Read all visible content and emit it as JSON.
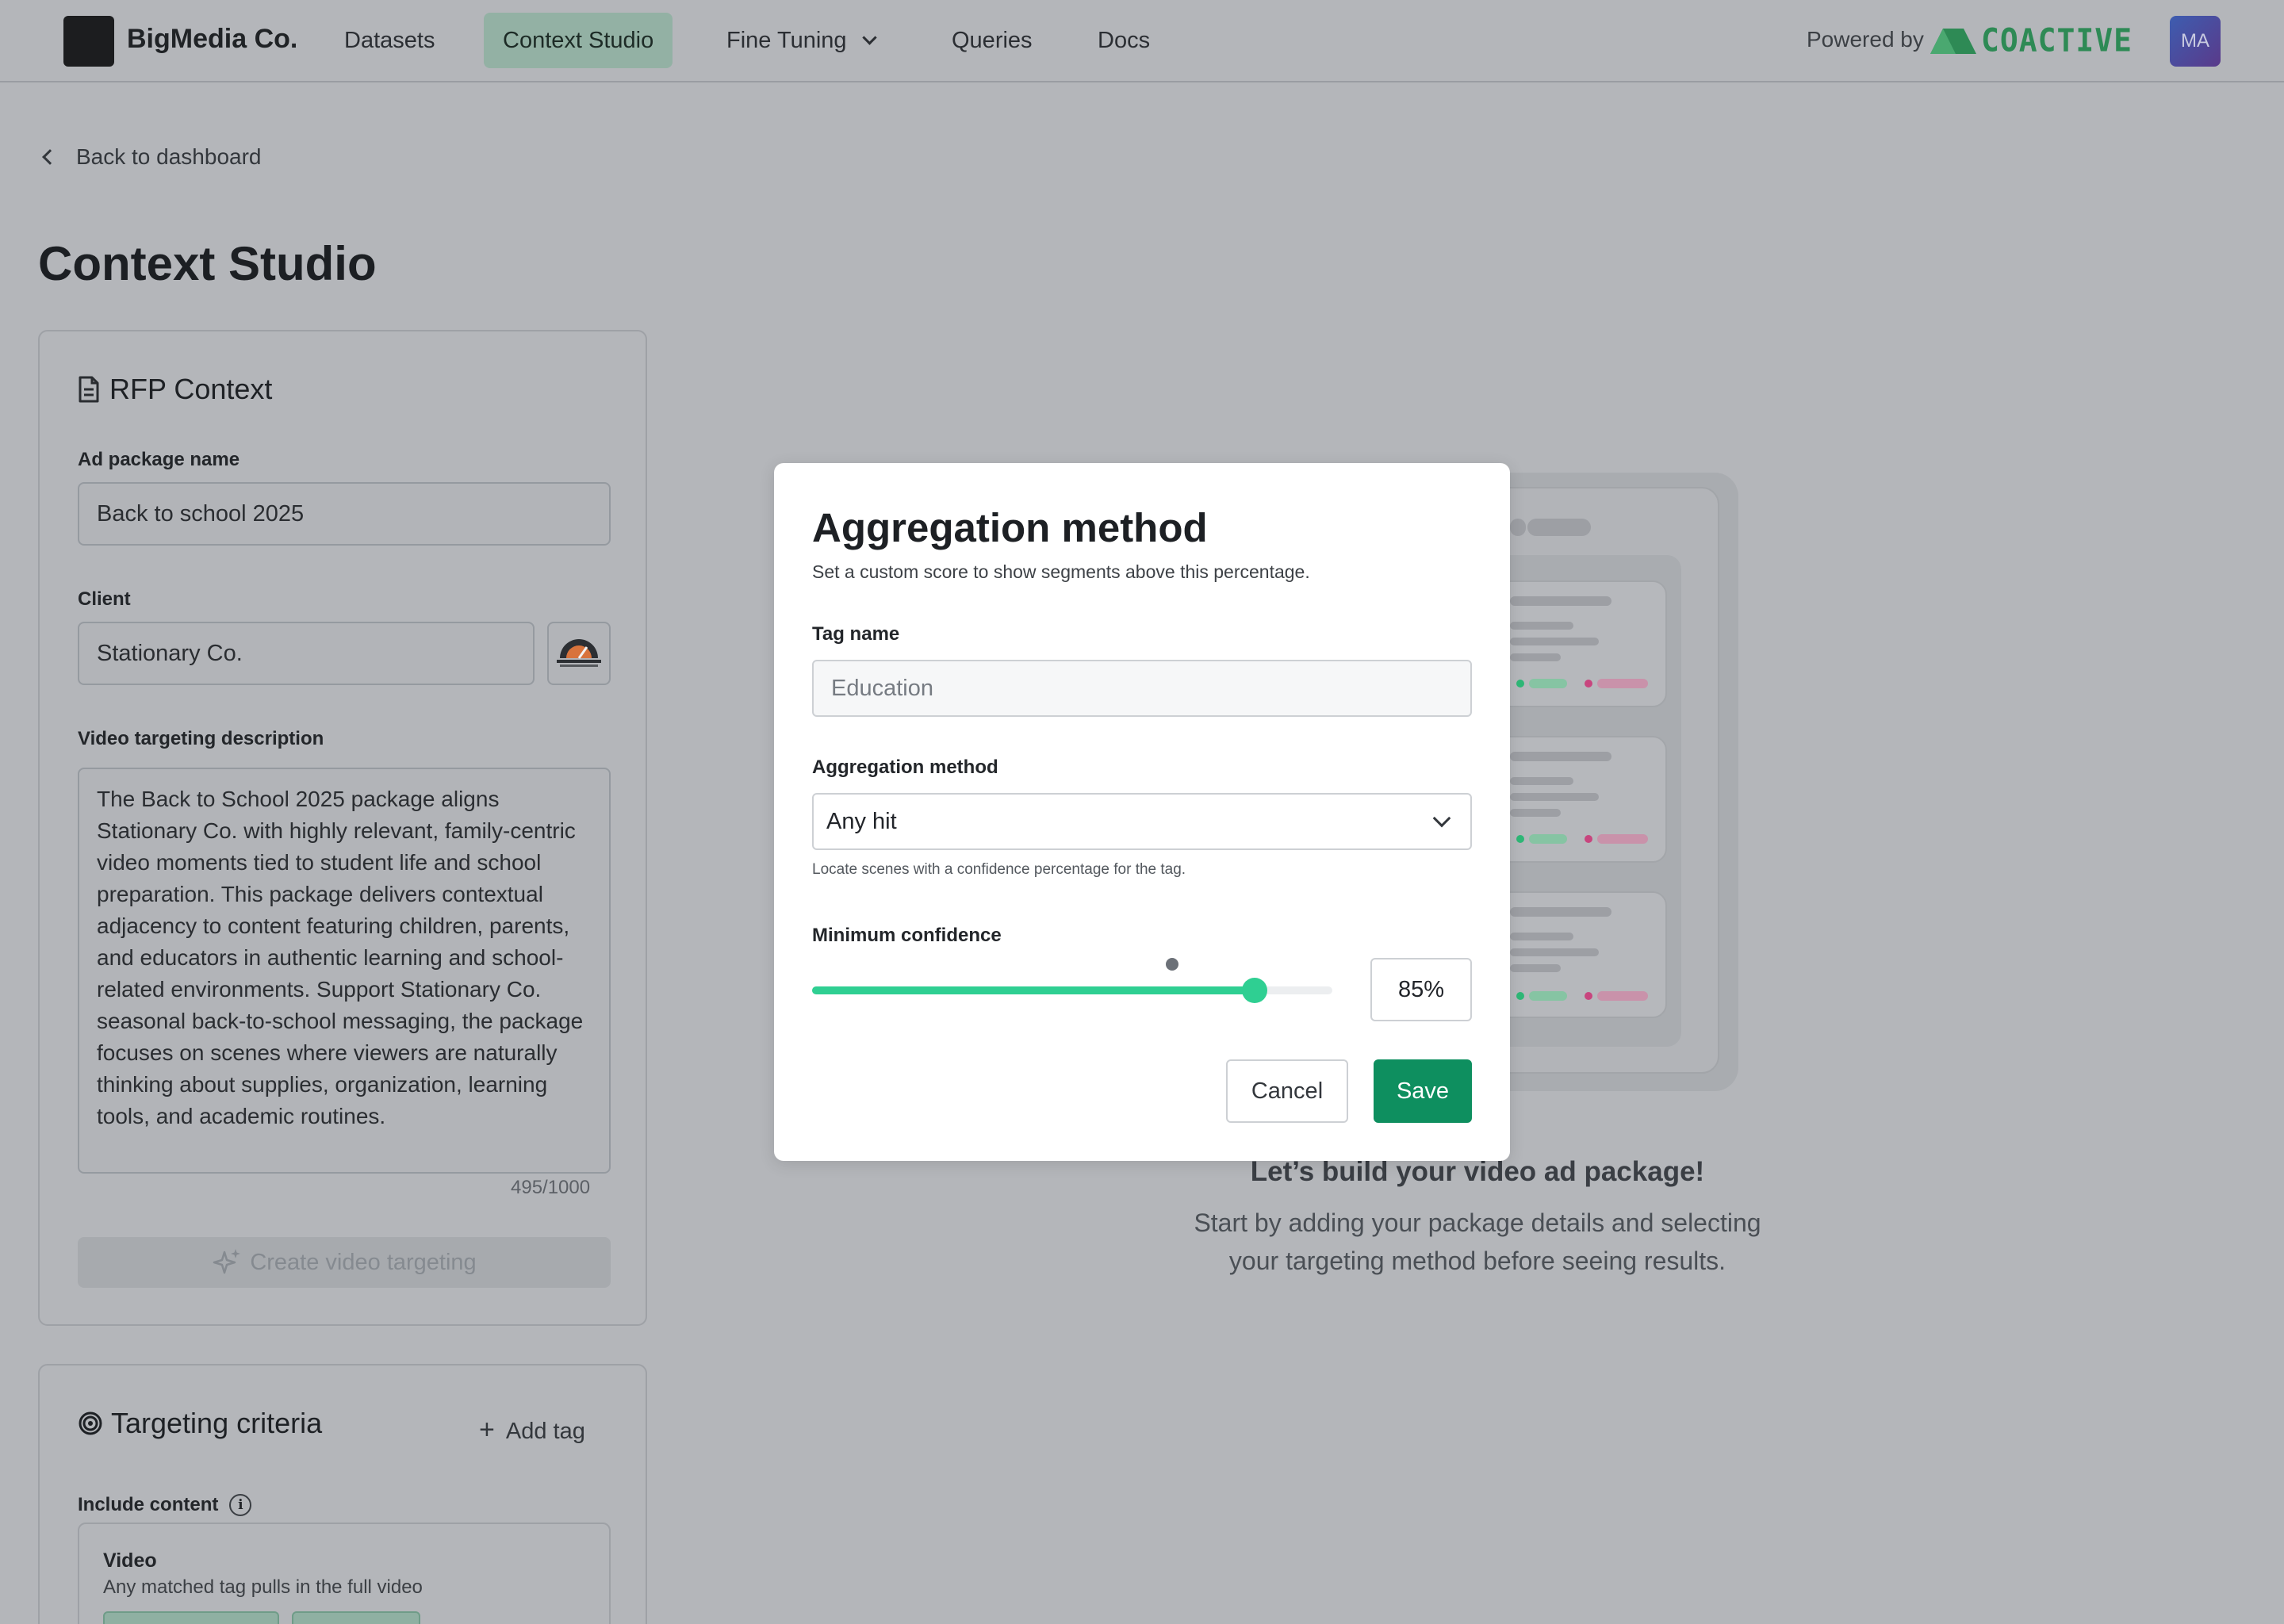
{
  "nav": {
    "brand_name": "BigMedia Co.",
    "items": [
      {
        "label": "Datasets"
      },
      {
        "label": "Context Studio"
      },
      {
        "label": "Fine Tuning"
      },
      {
        "label": "Queries"
      },
      {
        "label": "Docs"
      }
    ],
    "powered_by": "Powered by",
    "partner_name": "COACTIVE",
    "avatar_initials": "MA",
    "colors": {
      "active_tab": "#93b1a4",
      "partner_green": "#2e8a55"
    }
  },
  "page": {
    "back_link": "Back to dashboard",
    "title": "Context Studio"
  },
  "rfp": {
    "title": "RFP Context",
    "package_label": "Ad package name",
    "package_value": "Back to school 2025",
    "client_label": "Client",
    "client_value": "Stationary Co.",
    "description_label": "Video targeting description",
    "description_value": "The Back to School 2025 package aligns Stationary Co. with highly relevant, family-centric video moments tied to student life and school preparation. This package delivers contextual adjacency to content featuring children, parents, and educators in authentic learning and school-related environments. Support Stationary Co. seasonal back-to-school messaging, the package focuses on scenes where viewers are naturally thinking about supplies, organization, learning tools, and academic routines.",
    "char_count": "495/1000",
    "create_button": "Create video targeting"
  },
  "targeting": {
    "title": "Targeting criteria",
    "add_tag": "Add tag",
    "include_label": "Include content",
    "video_title": "Video",
    "video_subtitle": "Any matched tag pulls in the full video"
  },
  "empty_state": {
    "title": "Let’s build your video ad package!",
    "subtitle": "Start by adding your package details and selecting your targeting method before seeing results."
  },
  "modal": {
    "title": "Aggregation method",
    "subtitle": "Set a custom score to show segments above this percentage.",
    "tag_label": "Tag name",
    "tag_placeholder": "Education",
    "method_label": "Aggregation method",
    "method_value": "Any hit",
    "method_help": "Locate scenes with a confidence percentage for the tag.",
    "confidence_label": "Minimum confidence",
    "confidence_value": 0.85,
    "confidence_text": "85%",
    "cancel": "Cancel",
    "save": "Save",
    "colors": {
      "accent": "#2fcf92",
      "save": "#0e8f5f"
    }
  }
}
